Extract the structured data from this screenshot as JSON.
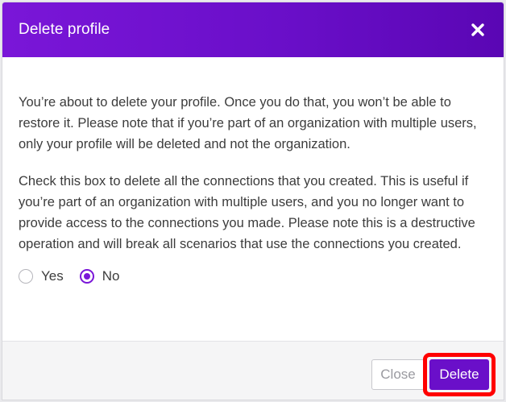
{
  "dialog": {
    "title": "Delete profile",
    "close_icon": "close-x-icon",
    "paragraph1": "You’re about to delete your profile. Once you do that, you won’t be able to restore it. Please note that if you’re part of an organization with multiple users, only your profile will be deleted and not the organization.",
    "paragraph2": "Check this box to delete all the connections that you created. This is useful if you’re part of an organization with multiple users, and you no longer want to provide access to the connections you made. Please note this is a destructive operation and will break all scenarios that use the connections you created.",
    "options": [
      {
        "label": "Yes",
        "selected": false
      },
      {
        "label": "No",
        "selected": true
      }
    ],
    "buttons": {
      "close_label": "Close",
      "delete_label": "Delete"
    }
  },
  "colors": {
    "header_accent": "#6a0fc9",
    "delete_button": "#6a0fc9",
    "highlight_border": "#ff0000"
  }
}
